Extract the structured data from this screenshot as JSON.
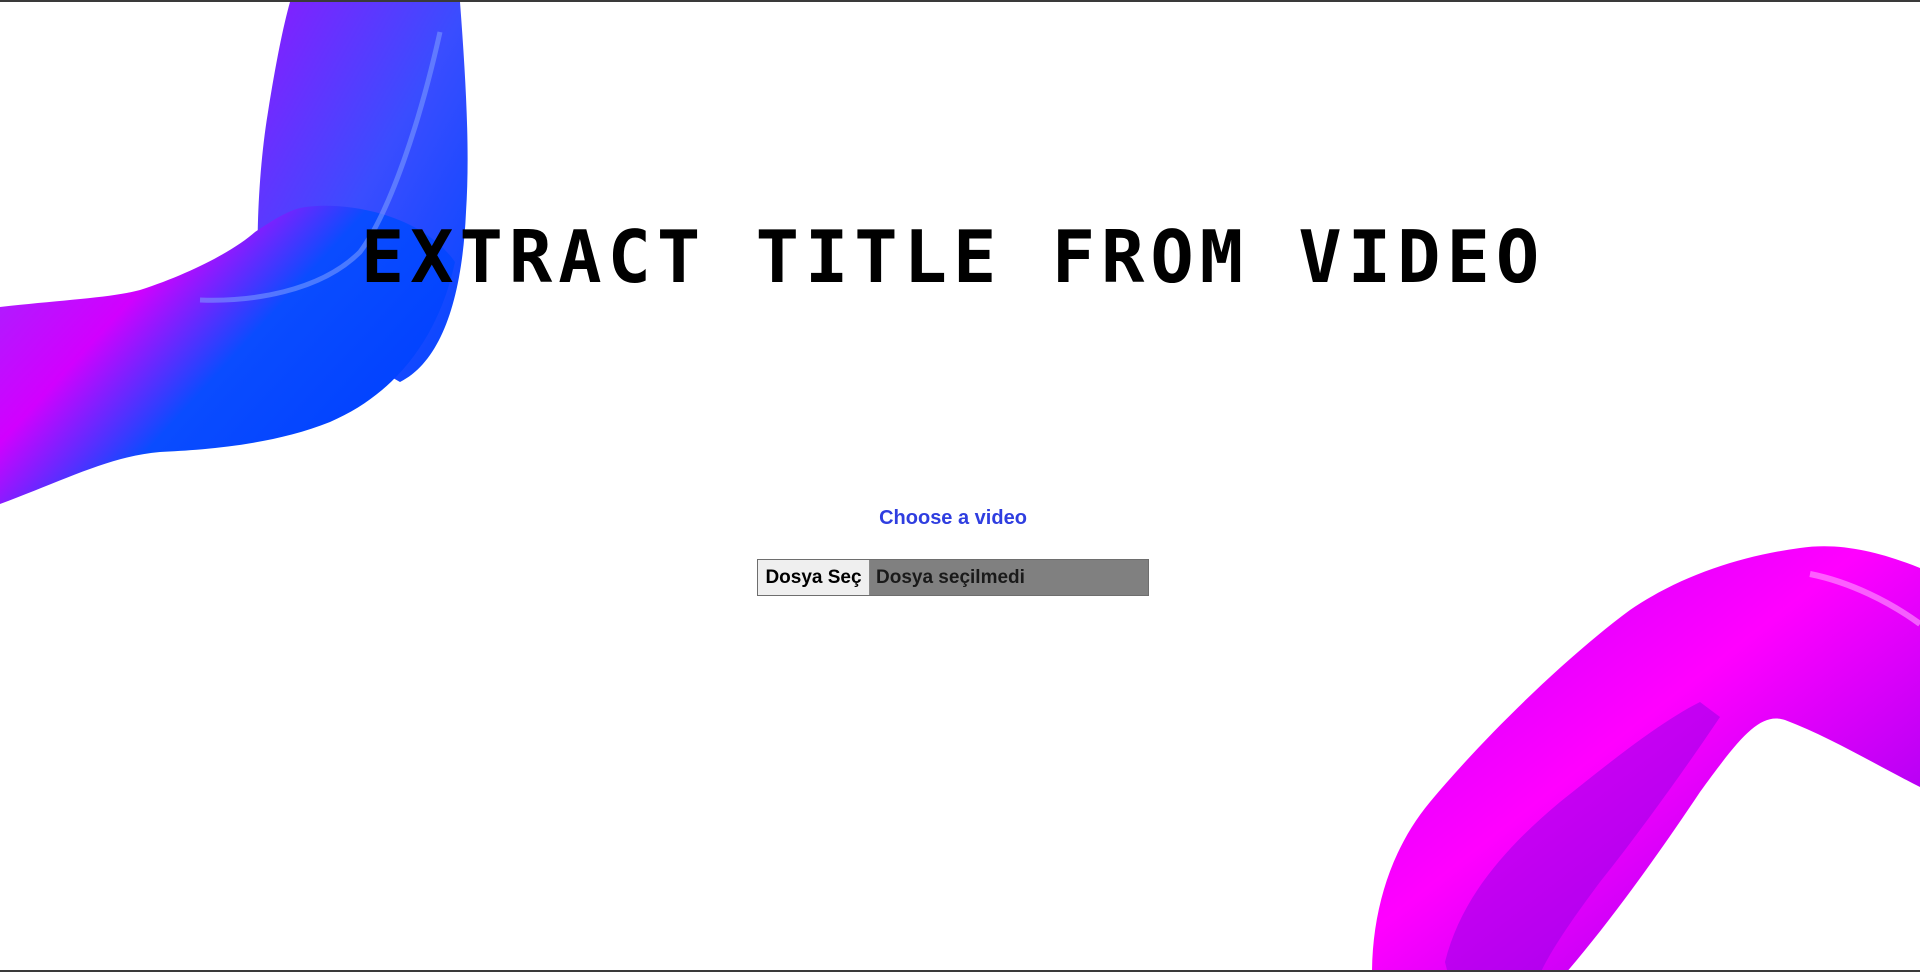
{
  "page": {
    "title": "EXTRACT TITLE FROM VIDEO"
  },
  "upload": {
    "label": "Choose a video",
    "button_label": "Dosya Seç",
    "status_text": "Dosya seçilmedi"
  },
  "colors": {
    "label_text": "#2f3ee0",
    "file_status_bg": "#808080",
    "file_status_text": "#1a1a1a",
    "ribbon_blue": "#0048ff",
    "ribbon_magenta": "#ff00ff",
    "ribbon_violet": "#7a00ff"
  }
}
